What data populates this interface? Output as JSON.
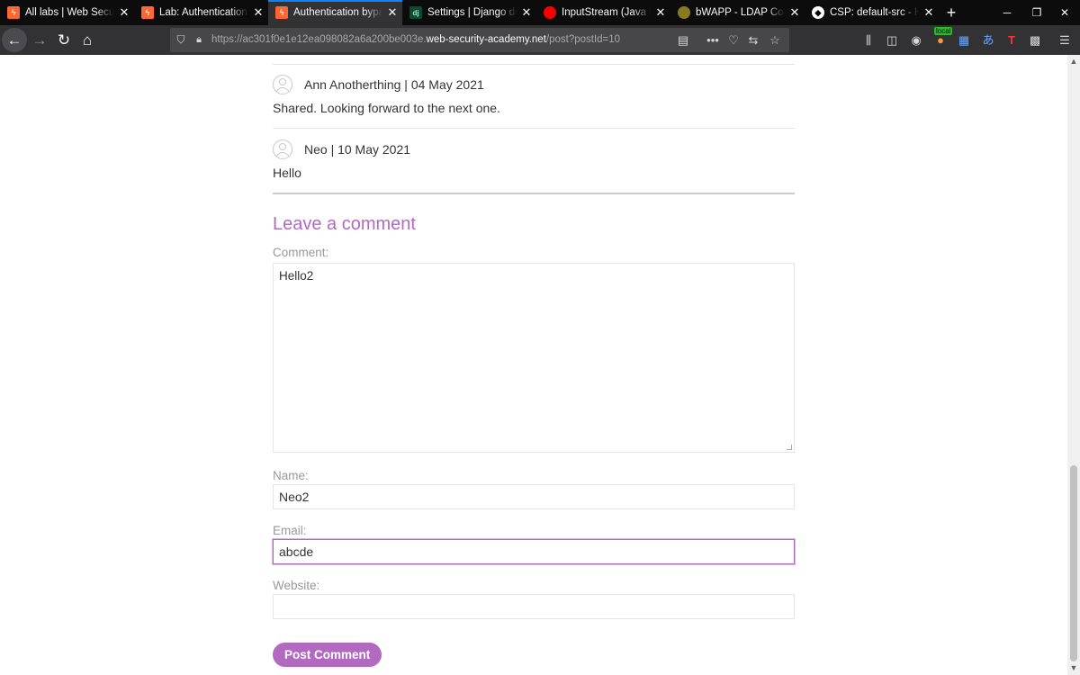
{
  "browser": {
    "tabs": [
      {
        "title": "All labs | Web Security Academy",
        "favicon": "burp-icon"
      },
      {
        "title": "Lab: Authentication bypass",
        "favicon": "burp-icon"
      },
      {
        "title": "Authentication bypass",
        "favicon": "burp-icon",
        "active": true
      },
      {
        "title": "Settings | Django documentation",
        "favicon": "django-icon"
      },
      {
        "title": "InputStream (Java Platform)",
        "favicon": "oracle-icon"
      },
      {
        "title": "bWAPP - LDAP Connection",
        "favicon": "bwapp-icon"
      },
      {
        "title": "CSP: default-src - HTTP",
        "favicon": "mdn-icon"
      }
    ],
    "url_prefix": "https://ac301f0e1e12ea098082a6a200be003e.",
    "url_domain": "web-security-academy.net",
    "url_path": "/post?postId=10",
    "local_badge": "local",
    "accent_color": "#0a84ff"
  },
  "comments": [
    {
      "author": "Ann Anotherthing | 04 May 2021",
      "text": "Shared. Looking forward to the next one."
    },
    {
      "author": "Neo | 10 May 2021",
      "text": "Hello"
    }
  ],
  "form": {
    "title": "Leave a comment",
    "comment_label": "Comment:",
    "comment_value": "Hello2",
    "name_label": "Name:",
    "name_value": "Neo2",
    "email_label": "Email:",
    "email_value": "abcde",
    "website_label": "Website:",
    "website_value": "",
    "submit_label": "Post Comment",
    "accent_color": "#b16ac0"
  }
}
